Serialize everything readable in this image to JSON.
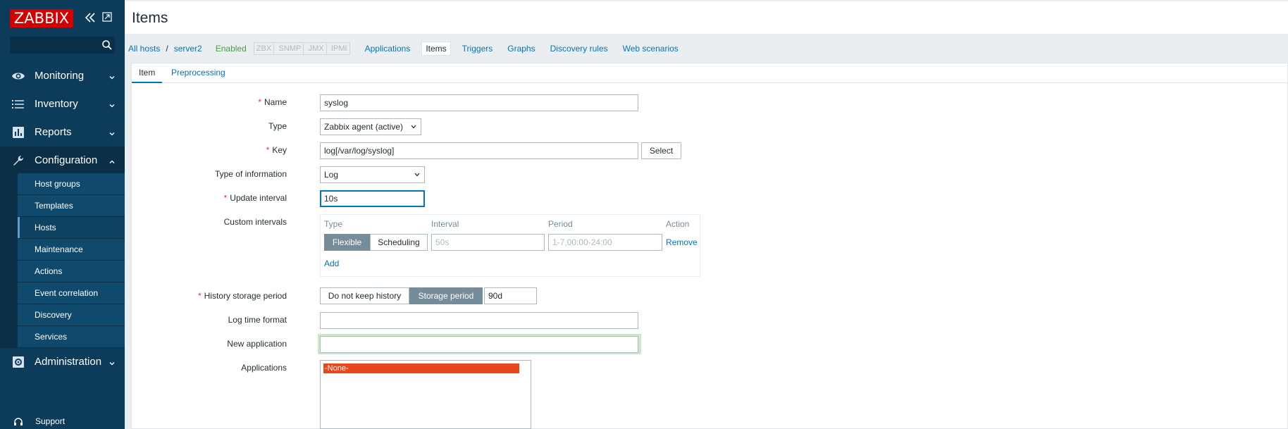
{
  "sidebar": {
    "logo": "ZABBIX",
    "search": {
      "value": "",
      "placeholder": ""
    },
    "menu": [
      {
        "label": "Monitoring",
        "icon": "eye-icon"
      },
      {
        "label": "Inventory",
        "icon": "list-icon"
      },
      {
        "label": "Reports",
        "icon": "bar-chart-icon"
      },
      {
        "label": "Configuration",
        "icon": "wrench-icon",
        "expanded": true
      },
      {
        "label": "Administration",
        "icon": "gear-icon"
      }
    ],
    "submenu": [
      {
        "label": "Host groups"
      },
      {
        "label": "Templates"
      },
      {
        "label": "Hosts",
        "selected": true
      },
      {
        "label": "Maintenance"
      },
      {
        "label": "Actions"
      },
      {
        "label": "Event correlation"
      },
      {
        "label": "Discovery"
      },
      {
        "label": "Services"
      }
    ],
    "support": "Support"
  },
  "header": {
    "title": "Items"
  },
  "hostnav": {
    "all_hosts": "All hosts",
    "separator": "/",
    "host": "server2",
    "status": "Enabled",
    "badges": [
      "ZBX",
      "SNMP",
      "JMX",
      "IPMI"
    ],
    "tabs": [
      "Applications",
      "Items",
      "Triggers",
      "Graphs",
      "Discovery rules",
      "Web scenarios"
    ],
    "active_tab": "Items"
  },
  "form_tabs": {
    "item": "Item",
    "preprocessing": "Preprocessing"
  },
  "form": {
    "name": {
      "label": "Name",
      "value": "syslog"
    },
    "type": {
      "label": "Type",
      "value": "Zabbix agent (active)"
    },
    "key": {
      "label": "Key",
      "value": "log[/var/log/syslog]",
      "button": "Select"
    },
    "type_of_info": {
      "label": "Type of information",
      "value": "Log"
    },
    "update_interval": {
      "label": "Update interval",
      "value": "10s"
    },
    "custom_intervals": {
      "label": "Custom intervals",
      "headers": {
        "type": "Type",
        "interval": "Interval",
        "period": "Period",
        "action": "Action"
      },
      "seg_flexible": "Flexible",
      "seg_scheduling": "Scheduling",
      "interval_placeholder": "50s",
      "period_placeholder": "1-7,00:00-24:00",
      "remove": "Remove",
      "add": "Add"
    },
    "history": {
      "label": "History storage period",
      "opt_no": "Do not keep history",
      "opt_storage": "Storage period",
      "value": "90d"
    },
    "log_time_format": {
      "label": "Log time format",
      "value": ""
    },
    "new_application": {
      "label": "New application",
      "value": ""
    },
    "applications": {
      "label": "Applications",
      "options": [
        "-None-"
      ]
    }
  },
  "colors": {
    "sidebar": "#0c3c5a",
    "accent": "#0275b8",
    "logo": "#d40000",
    "enabled": "#429e47",
    "required": "#e33734",
    "selected_option": "#e8471c"
  }
}
